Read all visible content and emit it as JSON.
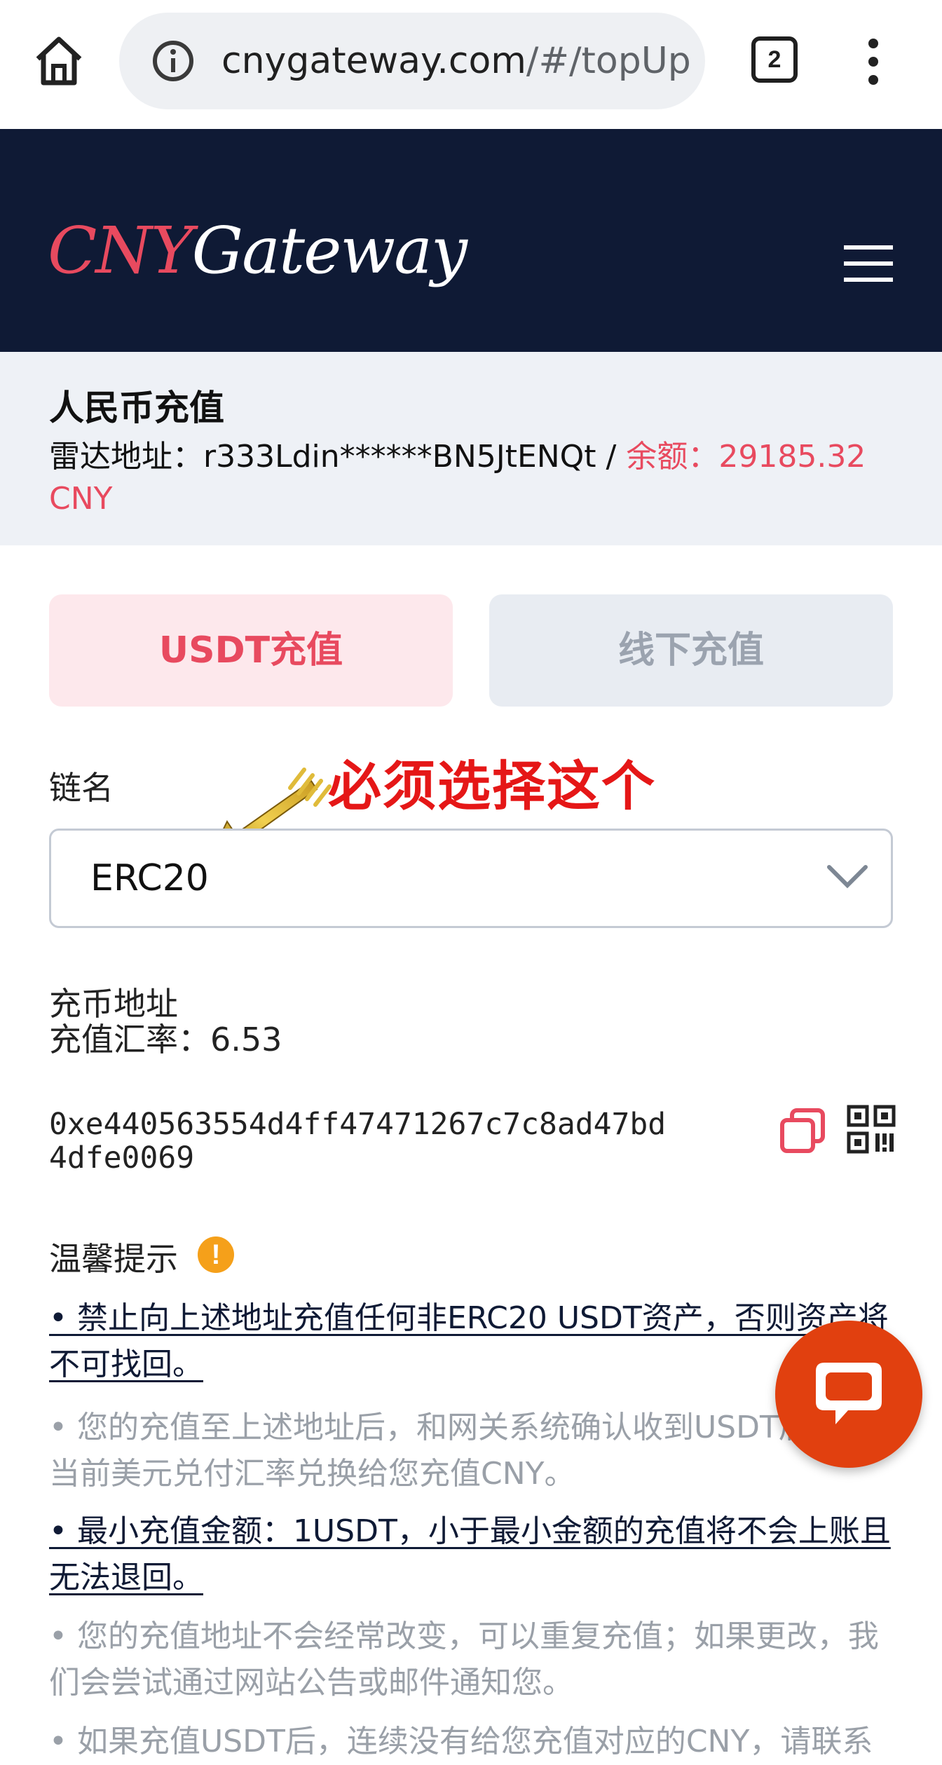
{
  "browser": {
    "url_host": "cnygateway.com",
    "url_path": "/#/topUp",
    "tab_count": "2"
  },
  "header": {
    "logo_part1": "CNY",
    "logo_part2": "Gateway"
  },
  "page": {
    "title": "人民币充值",
    "address_label": "雷达地址：",
    "address_value": "r333Ldin******BN5JtENQt",
    "separator": " / ",
    "balance_label": "余额：",
    "balance_value": "29185.32 CNY"
  },
  "tabs": {
    "usdt": "USDT充值",
    "offline": "线下充值"
  },
  "chain": {
    "label": "链名",
    "annotation": "必须选择这个",
    "selected": "ERC20"
  },
  "deposit": {
    "address_label": "充币地址",
    "rate_label": "充值汇率：",
    "rate_value": "6.53",
    "address": "0xe440563554d4ff47471267c7c8ad47bd4dfe0069"
  },
  "tips": {
    "title": "温馨提示",
    "items": [
      "• 禁止向上述地址充值任何非ERC20 USDT资产，否则资产将不可找回。",
      "• 您的充值至上述地址后，和网关系统确认收到USDT后按照当前美元兑付汇率兑换给您充值CNY。",
      "• 最小充值金额：1USDT，小于最小金额的充值将不会上账且无法退回。",
      "• 您的充值地址不会经常改变，可以重复充值；如果更改，我们会尝试通过网站公告或邮件通知您。",
      "• 如果充值USDT后，连续没有给您充值对应的CNY，请联系"
    ]
  },
  "colors": {
    "header_bg": "#0f1a35",
    "accent_red": "#e84a5f",
    "chat_orange": "#e1400f",
    "warning_orange": "#f5a01a"
  },
  "icons": [
    "home-icon",
    "info-icon",
    "tabs-icon",
    "more-icon",
    "hamburger-icon",
    "chevron-down-icon",
    "copy-icon",
    "qr-code-icon",
    "warning-icon",
    "chat-icon",
    "arrow-annotation-icon"
  ]
}
